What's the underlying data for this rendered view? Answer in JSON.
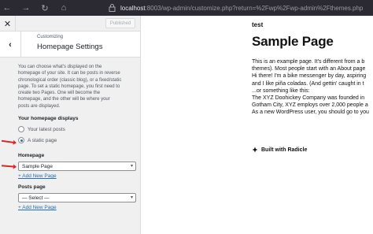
{
  "browser": {
    "url_host": "localhost",
    "url_rest": ":8003/wp-admin/customize.php?return=%2Fwp%2Fwp-admin%2Fthemes.php"
  },
  "sidebar": {
    "publish_label": "Published",
    "crumb": "Customizing",
    "title": "Homepage Settings",
    "description": "You can choose what's displayed on the homepage of your site. It can be posts in reverse chronological order (classic blog), or a fixed/static page. To set a static homepage, you first need to create two Pages. One will become the homepage, and the other will be where your posts are displayed.",
    "displays_label": "Your homepage displays",
    "options": [
      "Your latest posts",
      "A static page"
    ],
    "selected_option": "A static page",
    "homepage_label": "Homepage",
    "homepage_value": "Sample Page",
    "add_new_page_1": "+ Add New Page",
    "posts_label": "Posts page",
    "posts_value": "— Select —",
    "add_new_page_2": "+ Add New Page"
  },
  "preview": {
    "site_title": "test",
    "page_title": "Sample Page",
    "lines": [
      "This is an example page. It's different from a b",
      "themes). Most people start with an About page",
      "Hi there! I'm a bike messenger by day, aspiring",
      "and I like piña coladas. (And gettin' caught in t",
      "...or something like this:",
      "The XYZ Doohickey Company was founded in",
      "Gotham City, XYZ employs over 2,000 people a",
      "As a new WordPress user, you should go to you"
    ],
    "footer": "Built with Radicle"
  },
  "colors": {
    "accent": "#2271b1",
    "annotation": "#d62a2a"
  }
}
